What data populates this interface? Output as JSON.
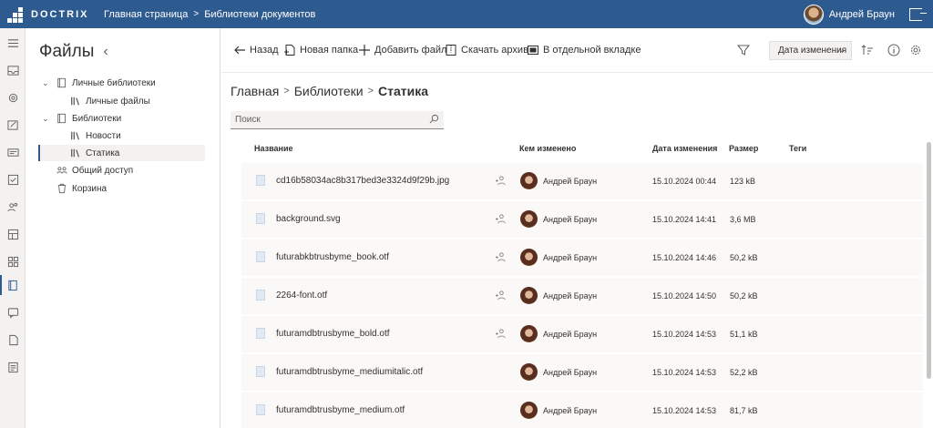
{
  "app": {
    "logo_text": "DOCTRIX",
    "accent": "#2d5a8f"
  },
  "topbar": {
    "breadcrumbs": [
      "Главная страница",
      "Библиотеки документов"
    ],
    "user_name": "Андрей Браун"
  },
  "rail": {
    "items": [
      "menu-icon",
      "inbox-icon",
      "settings-icon",
      "edit-icon",
      "card-icon",
      "checkbox-icon",
      "people-icon",
      "dashboard-icon",
      "apps-icon",
      "library-icon",
      "chat-icon",
      "document-icon",
      "report-icon"
    ],
    "active_index": 9
  },
  "side": {
    "title": "Файлы",
    "tree": [
      {
        "label": "Личные библиотеки",
        "icon": "library-icon",
        "expanded": true
      },
      {
        "label": "Личные файлы",
        "icon": "books-icon"
      },
      {
        "label": "Библиотеки",
        "icon": "library-icon",
        "expanded": true
      },
      {
        "label": "Новости",
        "icon": "books-icon"
      },
      {
        "label": "Статика",
        "icon": "books-icon",
        "selected": true
      },
      {
        "label": "Общий доступ",
        "icon": "people-icon"
      },
      {
        "label": "Корзина",
        "icon": "trash-icon"
      }
    ]
  },
  "toolbar": {
    "back": "Назад",
    "new_folder": "Новая папка",
    "add_file": "Добавить файл",
    "download_archive": "Скачать архив",
    "open_new_tab": "В отдельной вкладке",
    "sort_by": "Дата изменения"
  },
  "breadcrumb": [
    "Главная",
    "Библиотеки",
    "Статика"
  ],
  "search": {
    "placeholder": "Поиск"
  },
  "table": {
    "columns": {
      "name": "Название",
      "modified_by": "Кем изменено",
      "modified_date": "Дата изменения",
      "size": "Размер",
      "tags": "Теги"
    },
    "rows": [
      {
        "name": "cd16b58034ac8b317bed3e3324d9f29b.jpg",
        "shared": true,
        "modified_by": "Андрей Браун",
        "date": "15.10.2024 00:44",
        "size": "123 kB"
      },
      {
        "name": "background.svg",
        "shared": true,
        "modified_by": "Андрей Браун",
        "date": "15.10.2024 14:41",
        "size": "3,6 MB"
      },
      {
        "name": "futurabkbtrusbyme_book.otf",
        "shared": true,
        "modified_by": "Андрей Браун",
        "date": "15.10.2024 14:46",
        "size": "50,2 kB"
      },
      {
        "name": "2264-font.otf",
        "shared": true,
        "modified_by": "Андрей Браун",
        "date": "15.10.2024 14:50",
        "size": "50,2 kB"
      },
      {
        "name": "futuramdbtrusbyme_bold.otf",
        "shared": true,
        "modified_by": "Андрей Браун",
        "date": "15.10.2024 14:53",
        "size": "51,1 kB"
      },
      {
        "name": "futuramdbtrusbyme_mediumitalic.otf",
        "shared": false,
        "modified_by": "Андрей Браун",
        "date": "15.10.2024 14:53",
        "size": "52,2 kB"
      },
      {
        "name": "futuramdbtrusbyme_medium.otf",
        "shared": false,
        "modified_by": "Андрей Браун",
        "date": "15.10.2024 14:53",
        "size": "81,7 kB"
      }
    ]
  }
}
